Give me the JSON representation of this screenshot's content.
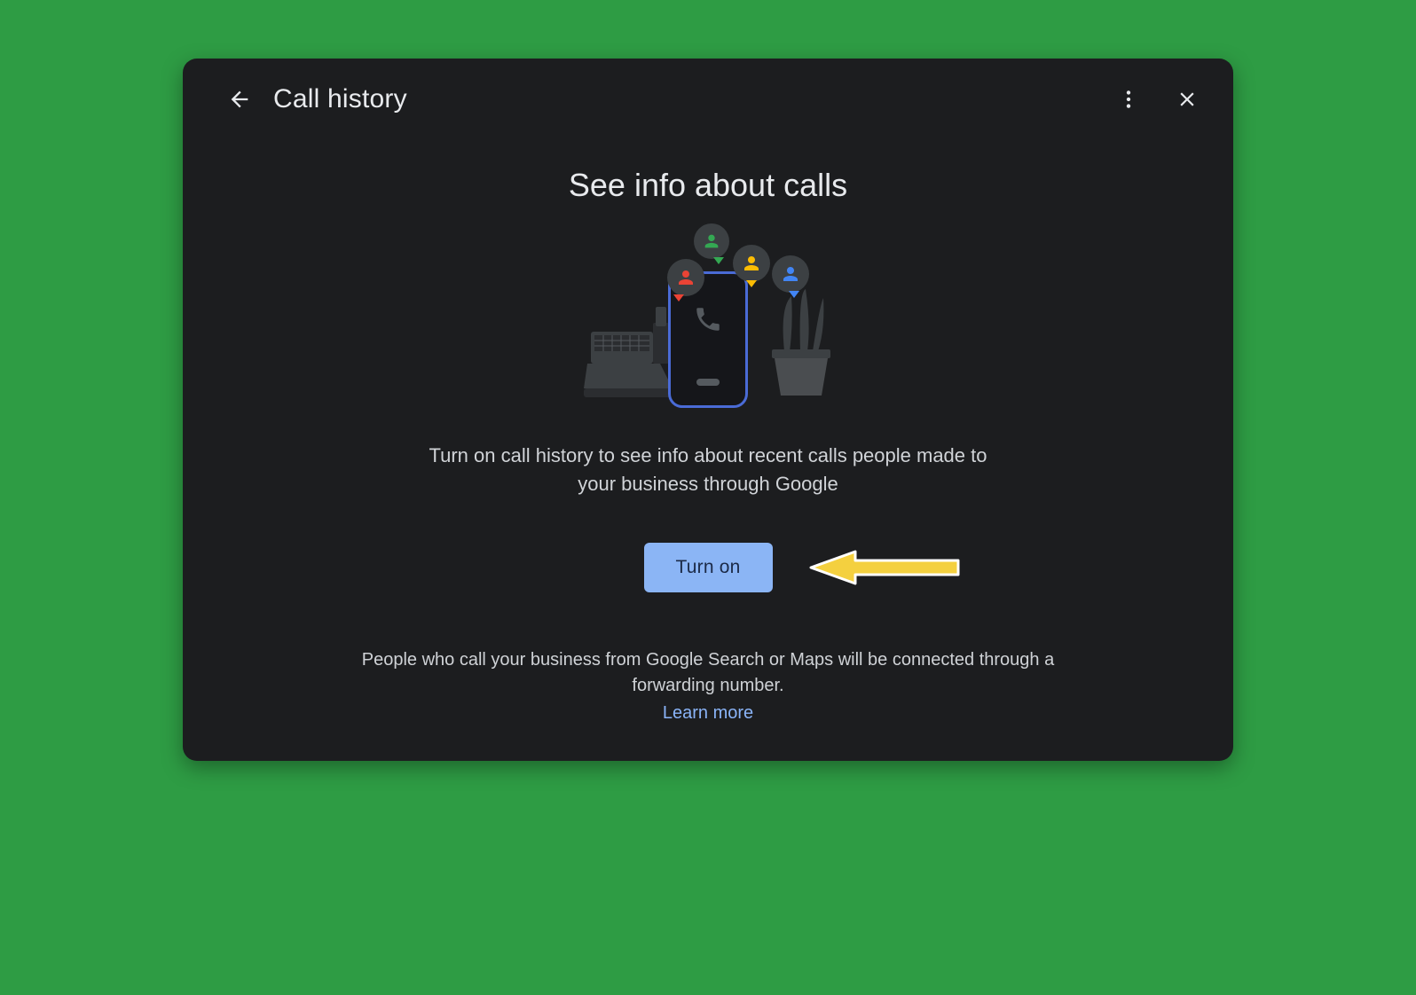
{
  "header": {
    "title": "Call history"
  },
  "main": {
    "headline": "See info about calls",
    "description": "Turn on call history to see info about recent calls people made to your business through Google",
    "cta_label": "Turn on",
    "footer_text": "People who call your business from Google Search or Maps will be connected through a forwarding number.",
    "learn_more_label": "Learn more"
  }
}
